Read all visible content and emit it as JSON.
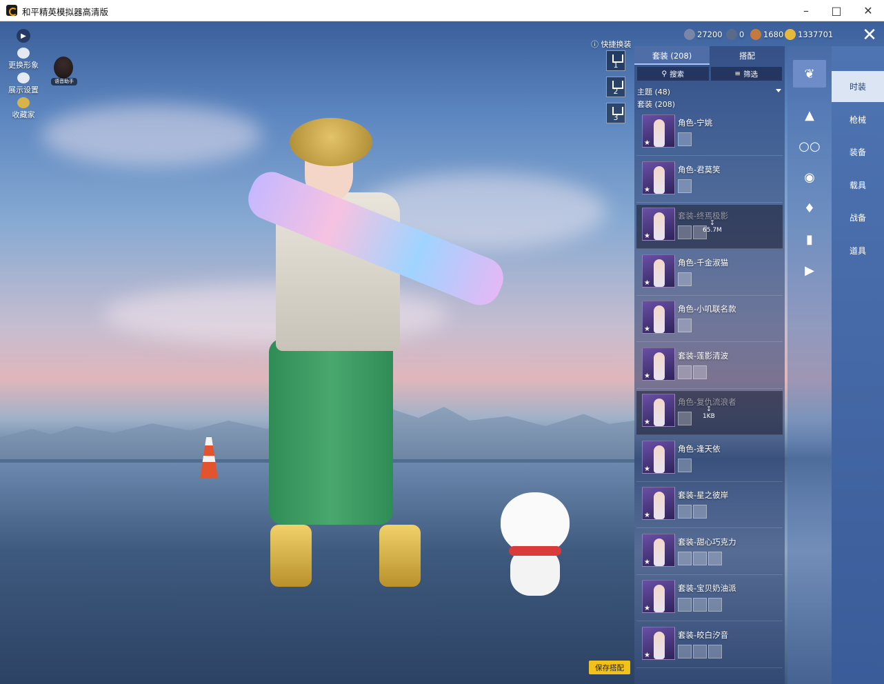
{
  "window": {
    "title": "和平精英模拟器高清版",
    "minimize_icon": "minimize-icon",
    "maximize_icon": "maximize-icon",
    "close_icon": "close-icon"
  },
  "left_toolbar": {
    "change_avatar": "更换形象",
    "display_settings": "展示设置",
    "favorites": "收藏家",
    "voice_assistant": "语音助手"
  },
  "currency": [
    {
      "icon": "gem-icon",
      "value": "27200",
      "color": "#7a86a8"
    },
    {
      "icon": "medal-icon",
      "value": "0",
      "color": "#5a6a8a"
    },
    {
      "icon": "silver-coin-icon",
      "value": "1680",
      "color": "#c47a3e"
    },
    {
      "icon": "gold-coin-icon",
      "value": "1337701",
      "color": "#e6b93a"
    }
  ],
  "quick_swap": {
    "label": "快捷换装",
    "presets": [
      "1",
      "2",
      "3"
    ]
  },
  "panel": {
    "tabs": [
      "套装 (208)",
      "搭配"
    ],
    "search_label": "搜索",
    "filter_label": "筛选",
    "theme_count": "主题 (48)",
    "outfit_count": "套装 (208)",
    "items": [
      {
        "name": "角色-宁姚",
        "dim": false,
        "subs": 1
      },
      {
        "name": "角色-君莫笑",
        "dim": false,
        "subs": 1
      },
      {
        "name": "套装-终焉极影",
        "dim": true,
        "subs": 2,
        "download": "65.7M"
      },
      {
        "name": "角色-千金淑猫",
        "dim": false,
        "subs": 1
      },
      {
        "name": "角色-小叽联名款",
        "dim": false,
        "subs": 1
      },
      {
        "name": "套装-莲影清波",
        "dim": false,
        "subs": 2
      },
      {
        "name": "角色-复仇流浪者",
        "dim": true,
        "subs": 1,
        "download": "1KB"
      },
      {
        "name": "角色-逢天依",
        "dim": false,
        "subs": 1
      },
      {
        "name": "套装-星之彼岸",
        "dim": false,
        "subs": 2
      },
      {
        "name": "套装-甜心巧克力",
        "dim": false,
        "subs": 3
      },
      {
        "name": "套装-宝贝奶油派",
        "dim": false,
        "subs": 3
      },
      {
        "name": "套装-皎白汐音",
        "dim": false,
        "subs": 3
      }
    ]
  },
  "category_icons": [
    "outfit-icon",
    "headwear-icon",
    "glasses-icon",
    "mask-icon",
    "jacket-icon",
    "pants-icon",
    "shoes-icon"
  ],
  "right_nav": [
    "时装",
    "枪械",
    "装备",
    "载具",
    "战备",
    "道具"
  ],
  "save_button": "保存搭配"
}
